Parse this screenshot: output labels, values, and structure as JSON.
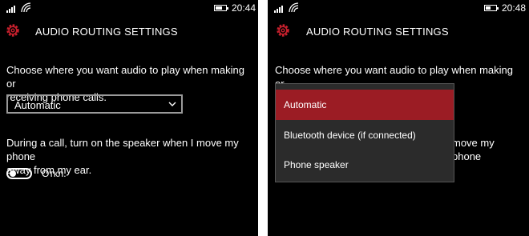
{
  "left": {
    "status": {
      "time": "20:44"
    },
    "header": {
      "title": "AUDIO ROUTING SETTINGS",
      "icon": "gear-icon"
    },
    "routing": {
      "description_line1": "Choose where you want audio to play when making or",
      "description_line2": "receiving phone calls.",
      "selected_value": "Automatic"
    },
    "speaker": {
      "description_line1": "During a call, turn on the speaker when I move my phone",
      "description_line2": "away from my ear.",
      "toggle_label": "Откл."
    }
  },
  "right": {
    "status": {
      "time": "20:48"
    },
    "header": {
      "title": "AUDIO ROUTING SETTINGS",
      "icon": "gear-icon"
    },
    "routing": {
      "description_line1": "Choose where you want audio to play when making or",
      "description_line2_partial": "receiving phone calls."
    },
    "speaker": {
      "partial_text": "move my phone"
    },
    "dropdown": {
      "options": [
        "Automatic",
        "Bluetooth device (if connected)",
        "Phone speaker"
      ],
      "selected": "Automatic"
    }
  },
  "colors": {
    "background": "#000000",
    "accent": "#9b1c24",
    "gear": "#c8202d",
    "dropdown_bg": "#2b2b2b"
  }
}
